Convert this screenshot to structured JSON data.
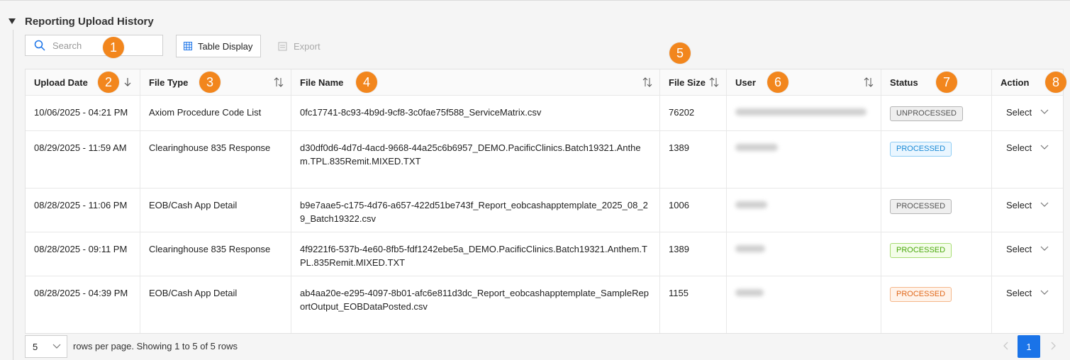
{
  "section": {
    "title": "Reporting Upload History"
  },
  "toolbar": {
    "search_placeholder": "Search",
    "table_display_label": "Table Display",
    "export_label": "Export"
  },
  "table": {
    "columns": [
      "Upload Date",
      "File Type",
      "File Name",
      "File Size",
      "User",
      "Status",
      "Action"
    ],
    "rows": [
      {
        "upload_date": "10/06/2025 - 04:21 PM",
        "file_type": "Axiom Procedure Code List",
        "file_name": "0fc17741-8c93-4b9d-9cf8-3c0fae75f588_ServiceMatrix.csv",
        "file_size": "76202",
        "status": "UNPROCESSED",
        "action": "Select"
      },
      {
        "upload_date": "08/29/2025 - 11:59 AM",
        "file_type": "Clearinghouse 835 Response",
        "file_name": "d30df0d6-4d7d-4acd-9668-44a25c6b6957_DEMO.PacificClinics.Batch19321.Anthem.TPL.835Remit.MIXED.TXT",
        "file_size": "1389",
        "status": "PROCESSED",
        "action": "Select"
      },
      {
        "upload_date": "08/28/2025 - 11:06 PM",
        "file_type": "EOB/Cash App Detail",
        "file_name": "b9e7aae5-c175-4d76-a657-422d51be743f_Report_eobcashapptemplate_2025_08_29_Batch19322.csv",
        "file_size": "1006",
        "status": "PROCESSED",
        "action": "Select"
      },
      {
        "upload_date": "08/28/2025 - 09:11 PM",
        "file_type": "Clearinghouse 835 Response",
        "file_name": "4f9221f6-537b-4e60-8fb5-fdf1242ebe5a_DEMO.PacificClinics.Batch19321.Anthem.TPL.835Remit.MIXED.TXT",
        "file_size": "1389",
        "status": "PROCESSED",
        "action": "Select"
      },
      {
        "upload_date": "08/28/2025 - 04:39 PM",
        "file_type": "EOB/Cash App Detail",
        "file_name": "ab4aa20e-e295-4097-8b01-afc6e811d3dc_Report_eobcashapptemplate_SampleReportOutput_EOBDataPosted.csv",
        "file_size": "1155",
        "status": "PROCESSED",
        "action": "Select"
      }
    ]
  },
  "footer": {
    "page_size": "5",
    "text": "rows per page. Showing 1 to 5 of 5 rows",
    "current_page": "1"
  },
  "callouts": [
    "1",
    "2",
    "3",
    "4",
    "5",
    "6",
    "7",
    "8"
  ],
  "colors": {
    "accent": "#1a73e8",
    "callout": "#f2861d"
  }
}
